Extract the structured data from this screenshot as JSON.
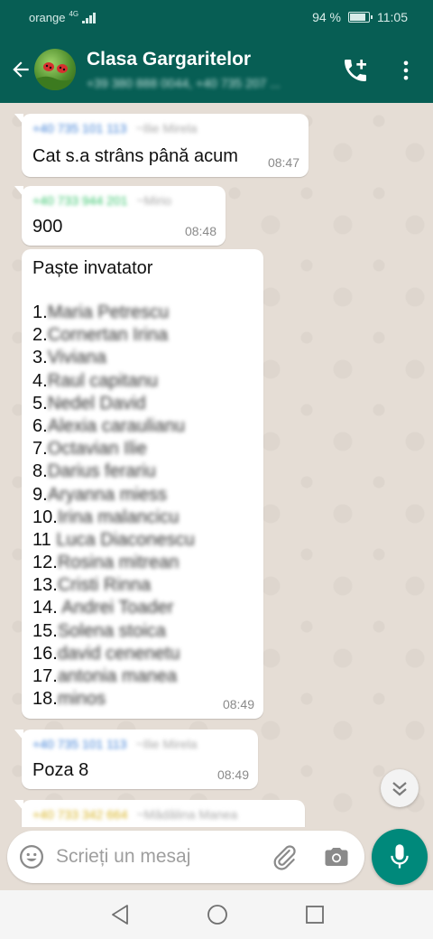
{
  "status_bar": {
    "carrier": "orange",
    "network": "4G",
    "battery": "94 %",
    "time": "11:05"
  },
  "header": {
    "title": "Clasa Gargaritelor",
    "subtitle": "+39 380 888 0044, +40 735 207 ..."
  },
  "messages": [
    {
      "sender_number": "+40 735 101 113",
      "sender_name": "~Ilie Mirela",
      "text": "Cat s.a strâns până acum",
      "time": "08:47",
      "sender_color": "#3d7fd6"
    },
    {
      "sender_number": "+40 733 944 201",
      "sender_name": "~Mirio",
      "text": "900",
      "time": "08:48",
      "sender_color": "#35c46a"
    },
    {
      "title": "Paște invatator",
      "time": "08:49",
      "list": [
        {
          "prefix": "1.",
          "name": "Maria Petrescu"
        },
        {
          "prefix": "2.",
          "name": "Cornertan Irina"
        },
        {
          "prefix": "3.",
          "name": "Viviana"
        },
        {
          "prefix": "4.",
          "name": "Raul capitanu"
        },
        {
          "prefix": "5.",
          "name": "Nedel David"
        },
        {
          "prefix": "6.",
          "name": "Alexia caraulianu"
        },
        {
          "prefix": "7.",
          "name": "Octavian Ilie"
        },
        {
          "prefix": "8.",
          "name": "Darius ferariu"
        },
        {
          "prefix": "9.",
          "name": "Aryanna miess"
        },
        {
          "prefix": "10.",
          "name": "Irina malancicu"
        },
        {
          "prefix": "11 ",
          "name": "Luca Diaconescu"
        },
        {
          "prefix": "12.",
          "name": "Rosina mitrean"
        },
        {
          "prefix": "13.",
          "name": "Cristi Rinna"
        },
        {
          "prefix": "14. ",
          "name": "Andrei Toader"
        },
        {
          "prefix": "15.",
          "name": "Solena stoica"
        },
        {
          "prefix": "16.",
          "name": "david cenenetu"
        },
        {
          "prefix": "17.",
          "name": "antonia manea"
        },
        {
          "prefix": "18.",
          "name": "minos"
        }
      ]
    },
    {
      "sender_number": "+40 735 101 113",
      "sender_name": "~Ilie Mirela",
      "text": "Poza 8",
      "time": "08:49",
      "sender_color": "#3d7fd6"
    },
    {
      "sender_number": "+40 733 342 664",
      "sender_name": "~Mădălina Manea",
      "sender_color": "#d7b21f"
    }
  ],
  "input": {
    "placeholder": "Scrieți un mesaj"
  },
  "icons": {
    "back": "arrow-left-icon",
    "call": "add-call-icon",
    "menu": "more-vert-icon",
    "emoji": "emoji-icon",
    "attach": "paperclip-icon",
    "camera": "camera-icon",
    "mic": "microphone-icon",
    "scroll": "double-chevron-down-icon"
  },
  "colors": {
    "header": "#075e54",
    "accent": "#00897b",
    "chat_bg": "#e5ddd5"
  }
}
